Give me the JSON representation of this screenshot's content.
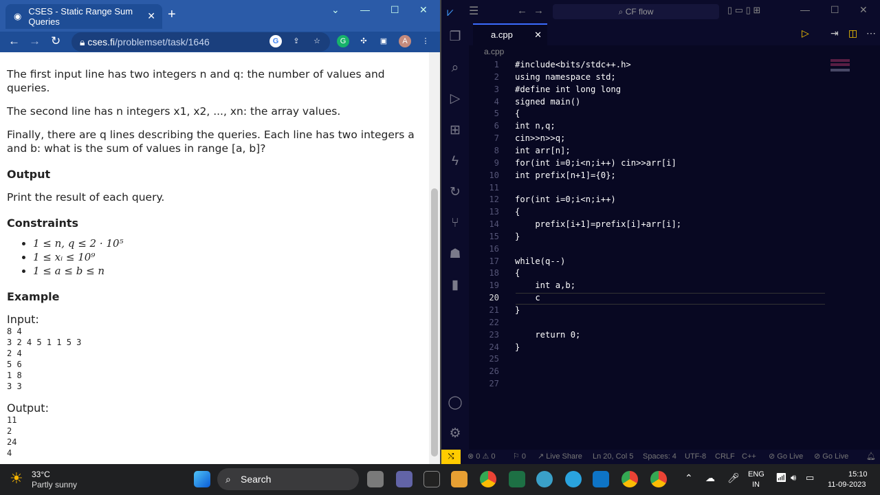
{
  "browser": {
    "tab_title": "CSES - Static Range Sum Queries",
    "url_host": "cses.fi",
    "url_path": "/problemset/task/1646",
    "avatar": "A"
  },
  "problem": {
    "p1": "The first input line has two integers n and q: the number of values and queries.",
    "p2": "The second line has n integers x1, x2, ..., xn: the array values.",
    "p3": "Finally, there are q lines describing the queries. Each line has two integers a and b: what is the sum of values in range [a, b]?",
    "output_heading": "Output",
    "output_text": "Print the result of each query.",
    "constraints_heading": "Constraints",
    "constraints": [
      "1 ≤ n, q ≤ 2 · 10⁵",
      "1 ≤ xᵢ ≤ 10⁹",
      "1 ≤ a ≤ b ≤ n"
    ],
    "example_heading": "Example",
    "input_label": "Input:",
    "input_lines": [
      "8 4",
      "3 2 4 5 1 1 5 3",
      "2 4",
      "5 6",
      "1 8",
      "3 3"
    ],
    "output_label": "Output:",
    "output_lines": [
      "11",
      "2",
      "24",
      "4"
    ]
  },
  "vscode": {
    "search": "CF flow",
    "file_tab": "a.cpp",
    "breadcrumb": "a.cpp",
    "status": {
      "errors": "0",
      "warnings": "0",
      "ports": "0",
      "live_share": "Live Share",
      "position": "Ln 20, Col 5",
      "spaces": "Spaces: 4",
      "encoding": "UTF-8",
      "eol": "CRLF",
      "lang": "C++",
      "go_live1": "Go Live",
      "go_live2": "Go Live"
    }
  },
  "code_lines": [
    "#include<bits/stdc++.h>",
    "using namespace std;",
    "#define int long long",
    "signed main()",
    "{",
    "int n,q;",
    "cin>>n>>q;",
    "int arr[n];",
    "for(int i=0;i<n;i++) cin>>arr[i]",
    "int prefix[n+1]={0};",
    "",
    "for(int i=0;i<n;i++)",
    "{",
    "    prefix[i+1]=prefix[i]+arr[i];",
    "}",
    "",
    "while(q--)",
    "{",
    "    int a,b;",
    "    c",
    "}",
    "",
    "    return 0;",
    "}",
    "",
    "",
    ""
  ],
  "taskbar": {
    "temp": "33°C",
    "weather": "Partly sunny",
    "search": "Search",
    "lang1": "ENG",
    "lang2": "IN",
    "time": "15:10",
    "date": "11-09-2023"
  }
}
